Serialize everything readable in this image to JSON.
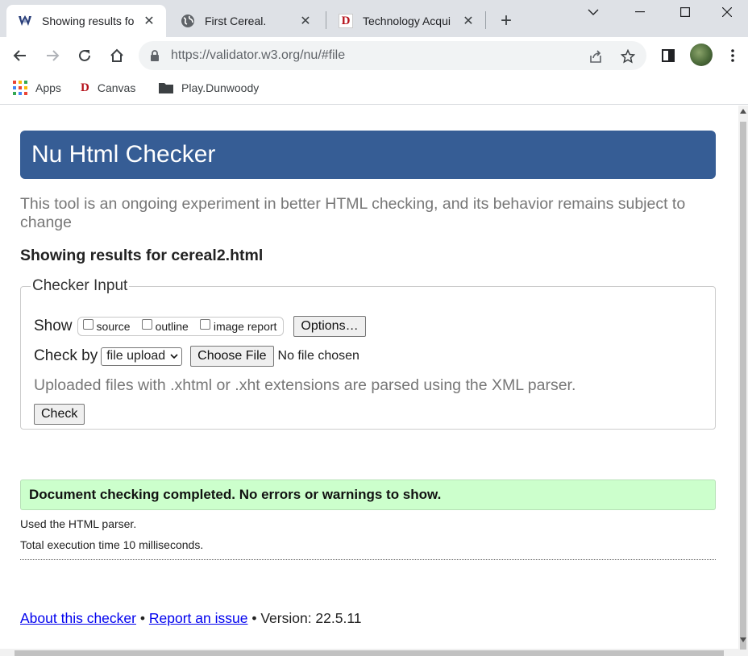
{
  "browser": {
    "tabs": [
      {
        "title": "Showing results fo",
        "favicon": "validator-icon",
        "active": true
      },
      {
        "title": "First Cereal.",
        "favicon": "globe-icon",
        "active": false
      },
      {
        "title": "Technology Acqui",
        "favicon": "d-logo-icon",
        "active": false
      }
    ],
    "url": "https://validator.w3.org/nu/#file",
    "bookmarks": [
      {
        "label": "Apps",
        "icon": "apps-grid-icon"
      },
      {
        "label": "Canvas",
        "icon": "d-logo-icon"
      },
      {
        "label": "Play.Dunwoody",
        "icon": "folder-icon"
      }
    ]
  },
  "page": {
    "banner_title": "Nu Html Checker",
    "intro": "This tool is an ongoing experiment in better HTML checking, and its behavior remains subject to change",
    "results_heading": "Showing results for cereal2.html",
    "checker_input": {
      "legend": "Checker Input",
      "show_label": "Show",
      "show_options": [
        "source",
        "outline",
        "image report"
      ],
      "options_button": "Options…",
      "check_by_label": "Check by",
      "check_by_value": "file upload",
      "choose_file_button": "Choose File",
      "file_status": "No file chosen",
      "note": "Uploaded files with .xhtml or .xht extensions are parsed using the XML parser.",
      "check_button": "Check"
    },
    "success_message": "Document checking completed. No errors or warnings to show.",
    "parser_info": "Used the HTML parser.",
    "execution_time": "Total execution time 10 milliseconds.",
    "footer": {
      "about_link": "About this checker",
      "separator": "•",
      "report_link": "Report an issue",
      "version": "Version: 22.5.11"
    }
  },
  "colors": {
    "banner": "#365d95",
    "success_bg": "#ccffcc",
    "link": "#0000ee",
    "muted_text": "#777777"
  }
}
